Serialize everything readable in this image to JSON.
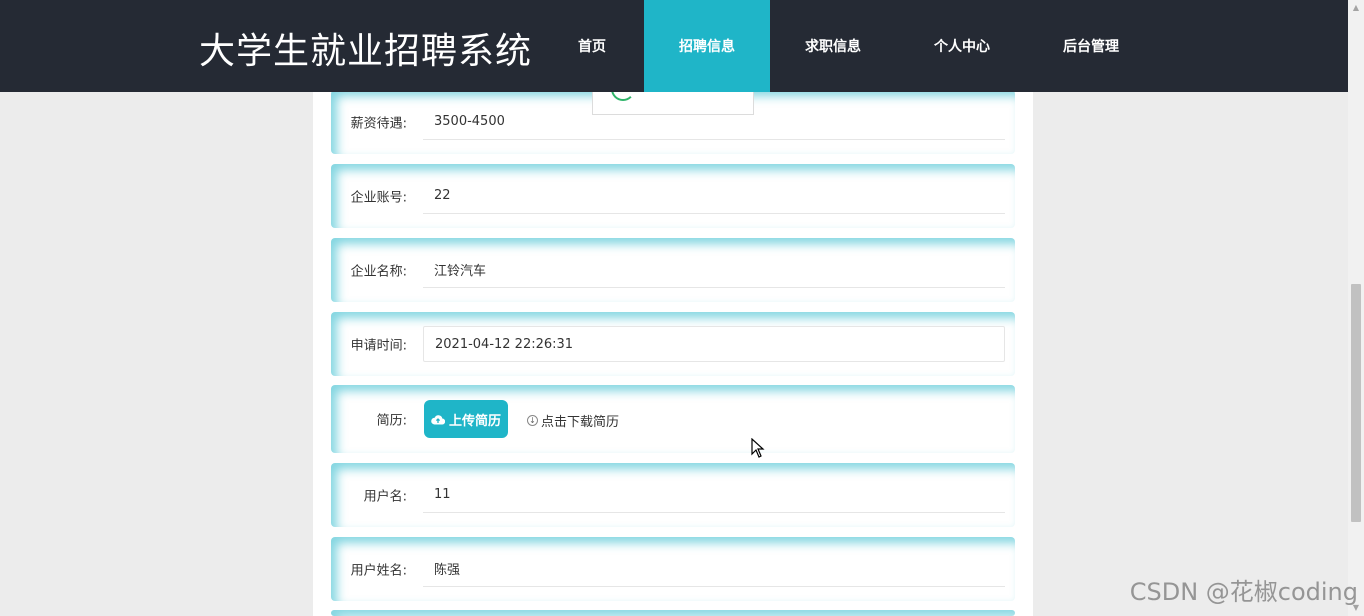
{
  "header": {
    "brand": "大学生就业招聘系统",
    "nav": [
      {
        "label": "首页",
        "active": false
      },
      {
        "label": "招聘信息",
        "active": true
      },
      {
        "label": "求职信息",
        "active": false
      },
      {
        "label": "个人中心",
        "active": false
      },
      {
        "label": "后台管理",
        "active": false
      }
    ]
  },
  "form": {
    "salary": {
      "label": "薪资待遇:",
      "value": "3500-4500"
    },
    "company_account": {
      "label": "企业账号:",
      "value": "22"
    },
    "company_name": {
      "label": "企业名称:",
      "value": "江铃汽车"
    },
    "apply_time": {
      "label": "申请时间:",
      "value": "2021-04-12 22:26:31"
    },
    "resume": {
      "label": "简历:",
      "upload_label": "上传简历",
      "download_label": "点击下载简历"
    },
    "username": {
      "label": "用户名:",
      "value": "11"
    },
    "real_name": {
      "label": "用户姓名:",
      "value": "陈强"
    }
  },
  "watermark": "CSDN @花椒coding",
  "colors": {
    "accent": "#1fb5c8",
    "header_bg": "#252a34"
  }
}
